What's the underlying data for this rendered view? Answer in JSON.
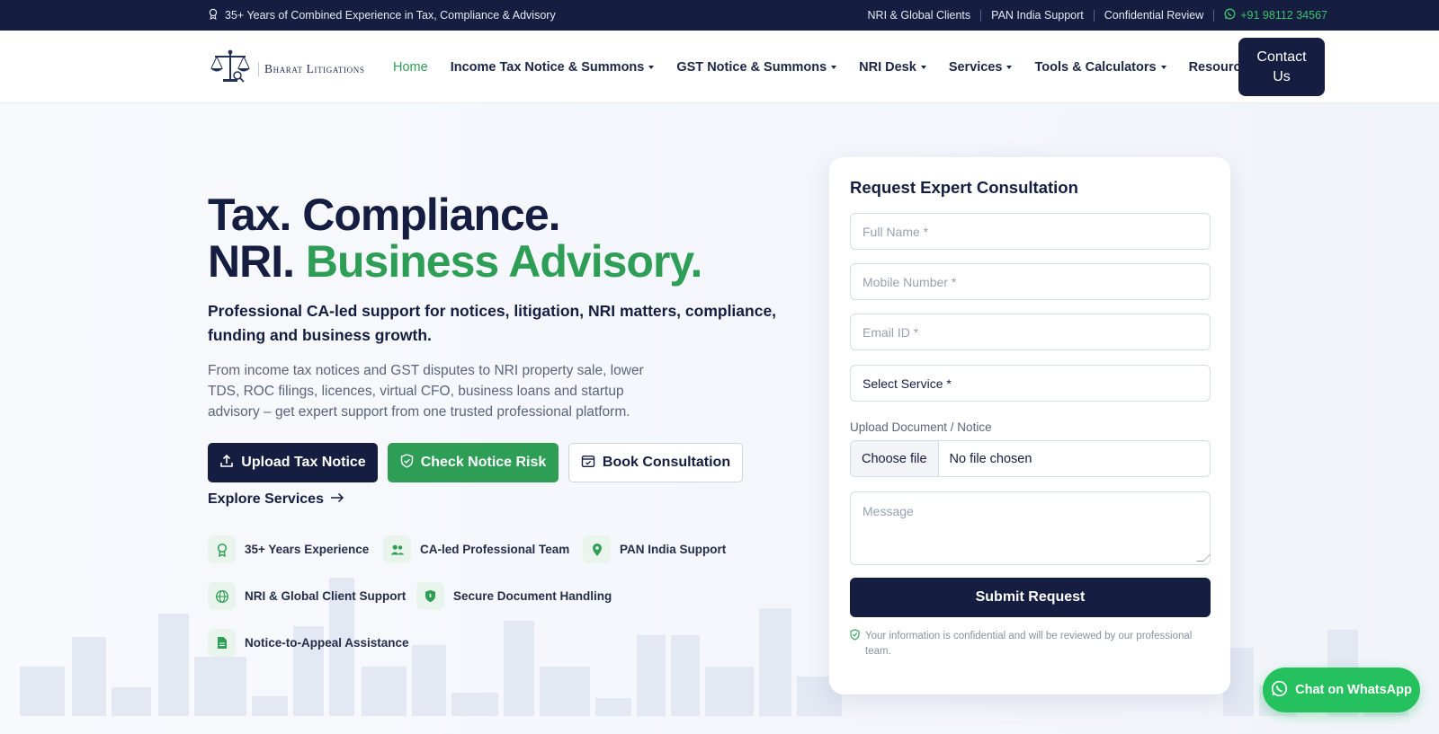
{
  "topbar": {
    "experience": "35+ Years of Combined Experience in Tax, Compliance & Advisory",
    "links": [
      "NRI & Global Clients",
      "PAN India Support",
      "Confidential Review"
    ],
    "phone": "+91 98112 34567"
  },
  "header": {
    "logo_text": "Bharat Litigations",
    "nav": [
      {
        "label": "Home",
        "active": true
      },
      {
        "label": "Income Tax Notice & Summons"
      },
      {
        "label": "GST Notice & Summons"
      },
      {
        "label": "NRI Desk"
      },
      {
        "label": "Services"
      },
      {
        "label": "Tools & Calculators"
      },
      {
        "label": "Resources"
      }
    ],
    "contact_label": "Contact Us"
  },
  "hero": {
    "title_line1": "Tax. Compliance.",
    "title_line2_a": "NRI. ",
    "title_line2_b": "Business Advisory.",
    "lead": "Professional CA-led support for notices, litigation, NRI matters, compliance, funding and business growth.",
    "description": "From income tax notices and GST disputes to NRI property sale, lower TDS, ROC filings, licences, virtual CFO, business loans and startup advisory – get expert support from one trusted professional platform.",
    "buttons": {
      "upload": "Upload Tax Notice",
      "check": "Check Notice Risk",
      "book": "Book Consultation"
    },
    "explore": "Explore Services",
    "features": [
      {
        "label": "35+ Years Experience",
        "icon": "award-icon"
      },
      {
        "label": "CA-led Professional Team",
        "icon": "team-icon"
      },
      {
        "label": "PAN India Support",
        "icon": "location-icon"
      },
      {
        "label": "NRI & Global Client Support",
        "icon": "globe-icon"
      },
      {
        "label": "Secure Document Handling",
        "icon": "shield-icon"
      },
      {
        "label": "Notice-to-Appeal Assistance",
        "icon": "document-icon"
      }
    ]
  },
  "form": {
    "title": "Request Expert Consultation",
    "full_name_placeholder": "Full Name *",
    "mobile_placeholder": "Mobile Number *",
    "email_placeholder": "Email ID *",
    "service_select": "Select Service *",
    "upload_label": "Upload Document / Notice",
    "choose_file": "Choose file",
    "no_file": "No file chosen",
    "message_placeholder": "Message",
    "submit": "Submit Request",
    "note": "Your information is confidential and will be reviewed by our professional team."
  },
  "whatsapp": {
    "label": "Chat on WhatsApp"
  },
  "colors": {
    "navy": "#151d40",
    "green": "#2e9d55",
    "whatsapp": "#26c15f"
  }
}
